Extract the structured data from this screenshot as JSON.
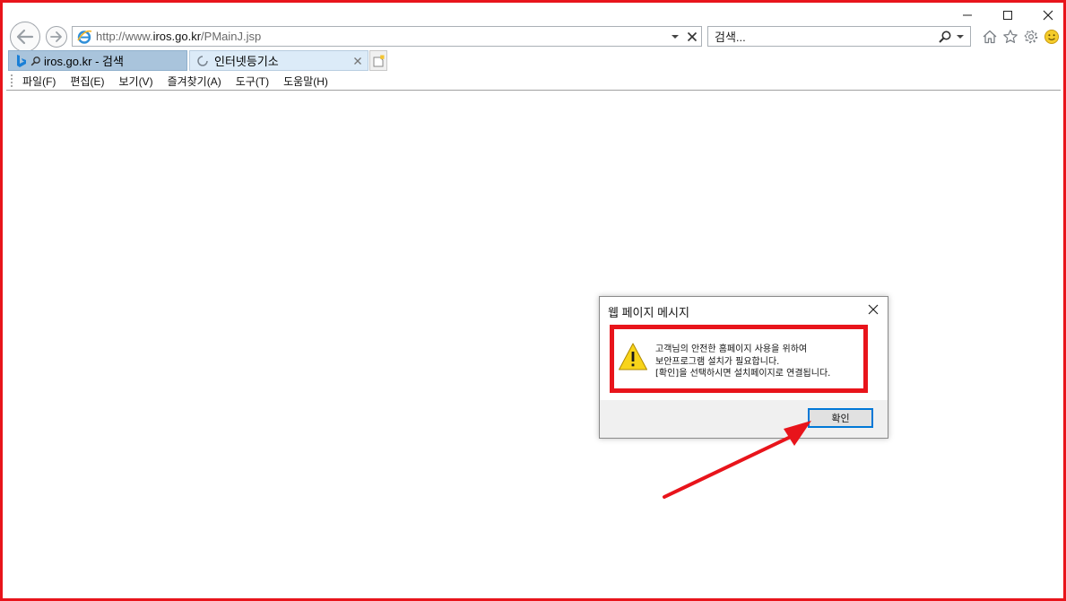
{
  "browser": {
    "address_url_prefix": "http://www.",
    "address_url_host": "iros.go.kr",
    "address_url_path": "/PMainJ.jsp",
    "search_placeholder": "검색..."
  },
  "tabs": [
    {
      "label": "iros.go.kr - 검색"
    },
    {
      "label": "인터넷등기소"
    }
  ],
  "menu": [
    {
      "label": "파일(F)"
    },
    {
      "label": "편집(E)"
    },
    {
      "label": "보기(V)"
    },
    {
      "label": "즐겨찾기(A)"
    },
    {
      "label": "도구(T)"
    },
    {
      "label": "도움말(H)"
    }
  ],
  "dialog": {
    "title": "웹 페이지 메시지",
    "message_lines": [
      "고객님의 안전한 홈페이지 사용을 위하여",
      "보안프로그램 설치가 필요합니다.",
      "[확인]을 선택하시면 설치페이지로 연결됩니다."
    ],
    "ok_label": "확인"
  },
  "colors": {
    "highlight": "#e8141b",
    "tab_active": "#a9c4dc",
    "button_focus": "#0078d7",
    "warning_fill": "#f8d41a"
  },
  "icons": {
    "back": "back-arrow-icon",
    "forward": "forward-arrow-icon",
    "ie": "ie-logo-icon",
    "bing": "bing-icon",
    "search": "search-icon",
    "home": "home-icon",
    "favorites": "star-icon",
    "settings": "gear-icon",
    "feedback": "smiley-icon",
    "loading": "loading-spinner-icon",
    "warning": "warning-icon"
  }
}
